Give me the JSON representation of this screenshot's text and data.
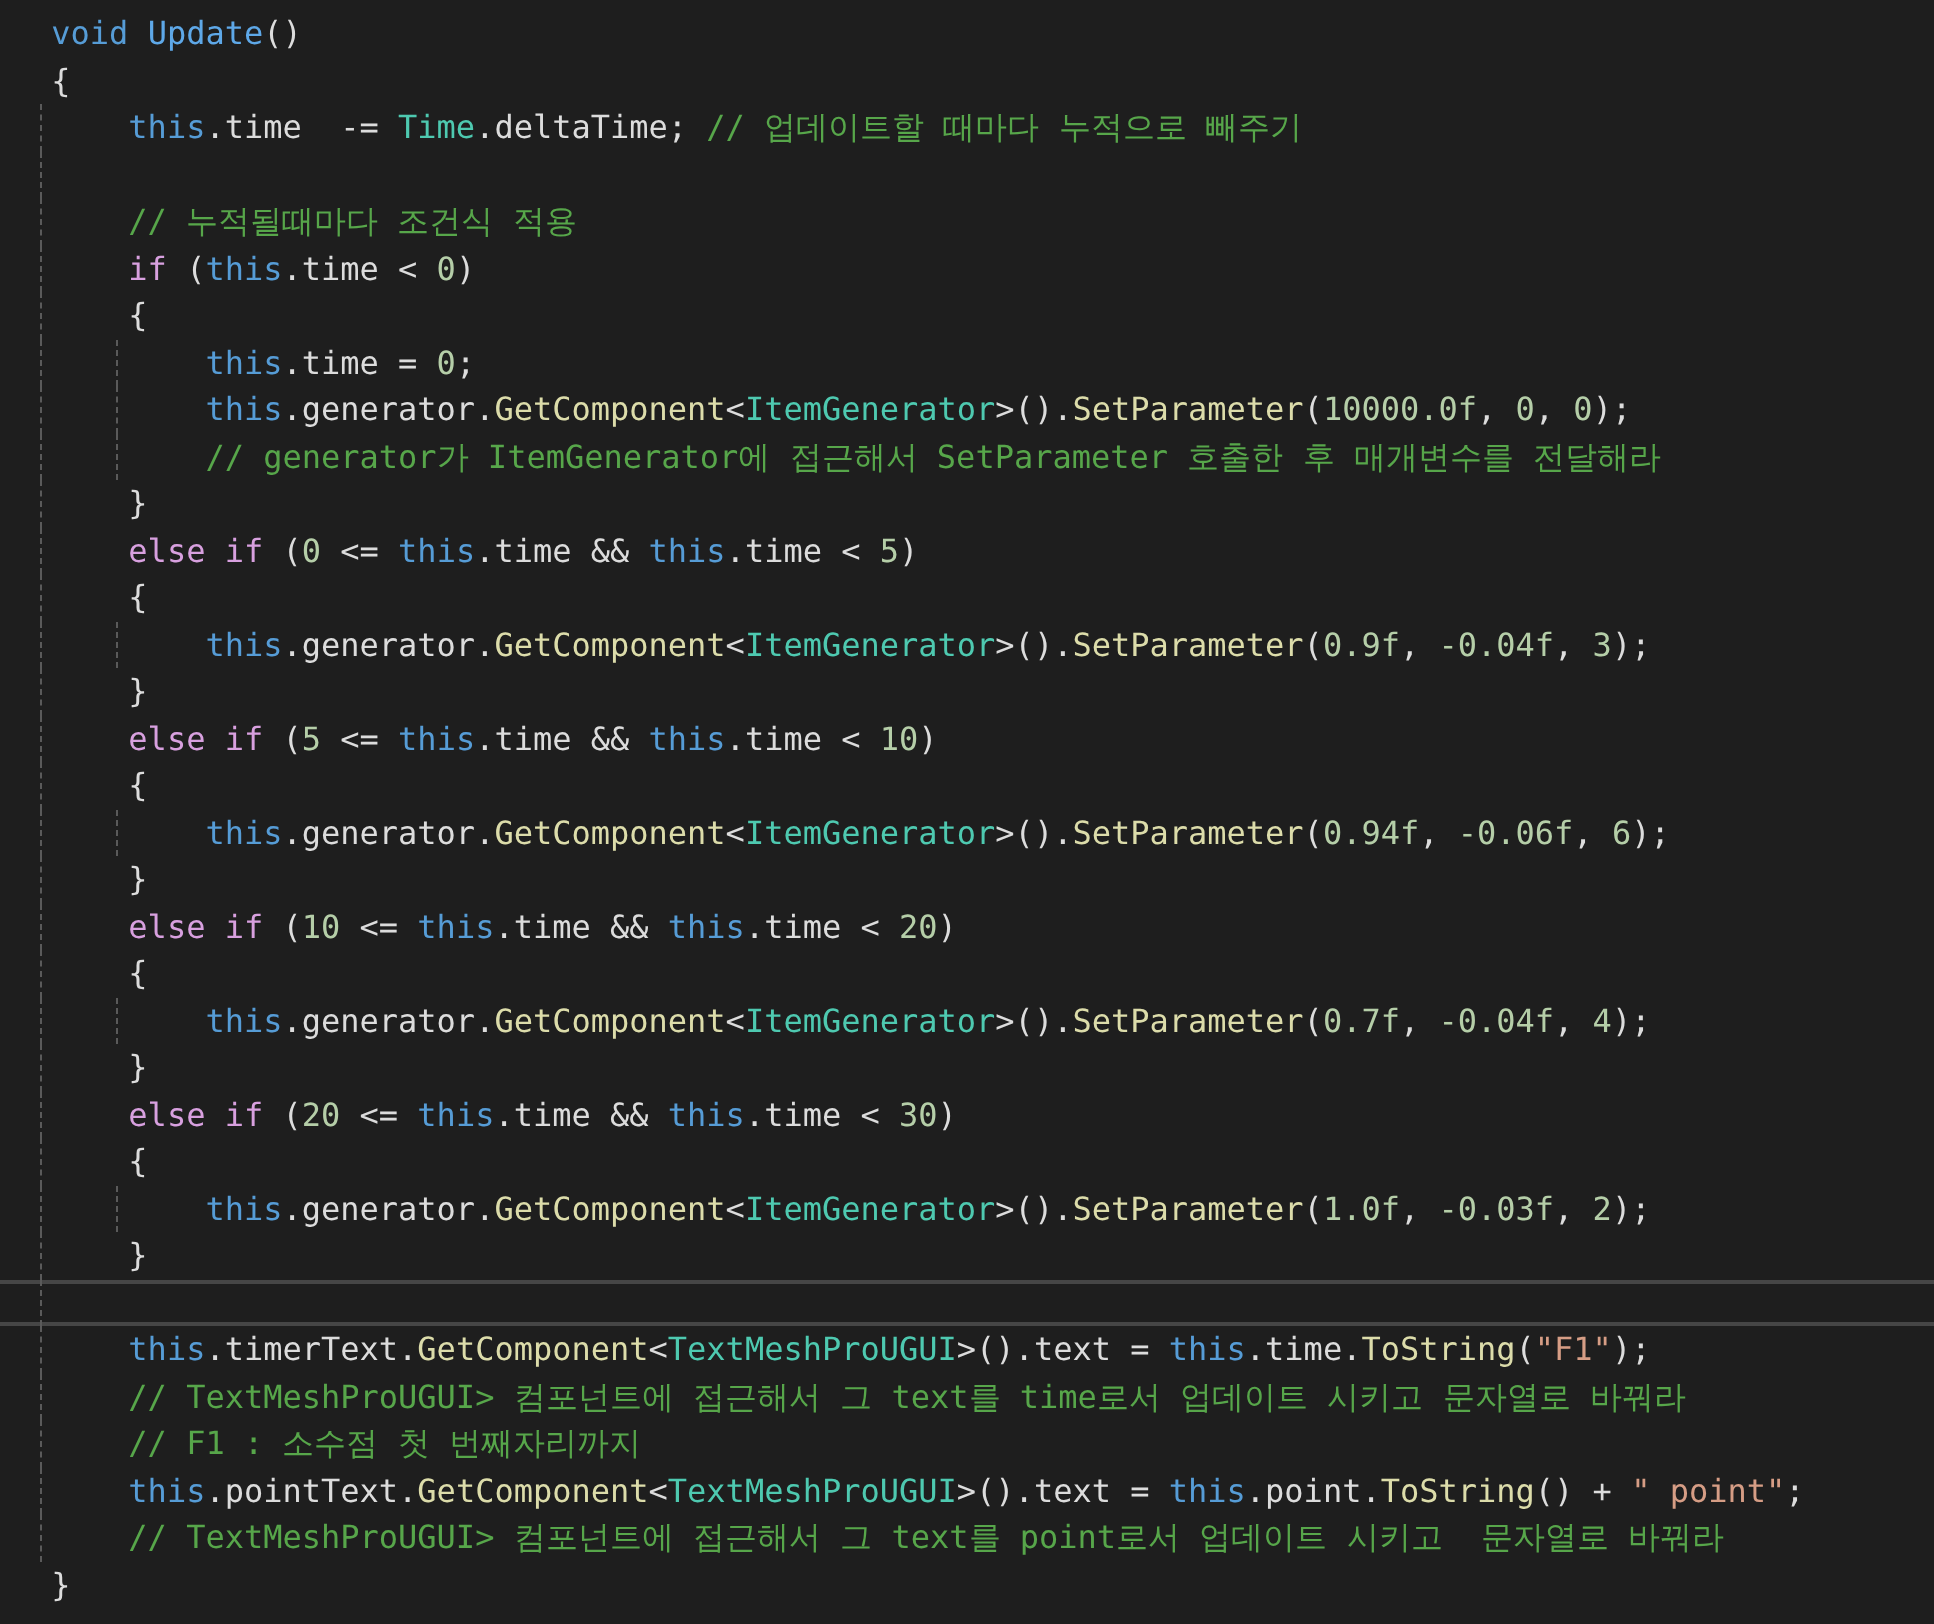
{
  "editor": {
    "lines": [
      {
        "current": false,
        "tokens": [
          {
            "kind": "kw",
            "text": "void "
          },
          {
            "kind": "decl",
            "text": "Update"
          },
          {
            "kind": "plain",
            "text": "()"
          }
        ]
      },
      {
        "current": false,
        "tokens": [
          {
            "kind": "plain",
            "text": "{"
          }
        ]
      },
      {
        "current": false,
        "tokens": [
          {
            "kind": "this",
            "text": "    this"
          },
          {
            "kind": "plain",
            "text": ".time  -= "
          },
          {
            "kind": "type",
            "text": "Time"
          },
          {
            "kind": "plain",
            "text": ".deltaTime; "
          },
          {
            "kind": "cmt",
            "text": "// 업데이트할 때마다 누적으로 빼주기"
          }
        ]
      },
      {
        "current": false
      },
      {
        "current": false,
        "tokens": [
          {
            "kind": "cmt",
            "text": "    // 누적될때마다 조건식 적용"
          }
        ]
      },
      {
        "current": false,
        "tokens": [
          {
            "kind": "ctl",
            "text": "    if"
          },
          {
            "kind": "plain",
            "text": " ("
          },
          {
            "kind": "this",
            "text": "this"
          },
          {
            "kind": "plain",
            "text": ".time < "
          },
          {
            "kind": "num",
            "text": "0"
          },
          {
            "kind": "plain",
            "text": ")"
          }
        ]
      },
      {
        "current": false,
        "tokens": [
          {
            "kind": "plain",
            "text": "    {"
          }
        ]
      },
      {
        "current": false,
        "tokens": [
          {
            "kind": "this",
            "text": "        this"
          },
          {
            "kind": "plain",
            "text": ".time = "
          },
          {
            "kind": "num",
            "text": "0"
          },
          {
            "kind": "plain",
            "text": ";"
          }
        ]
      },
      {
        "current": false,
        "tokens": [
          {
            "kind": "this",
            "text": "        this"
          },
          {
            "kind": "plain",
            "text": ".generator."
          },
          {
            "kind": "method",
            "text": "GetComponent"
          },
          {
            "kind": "plain",
            "text": "<"
          },
          {
            "kind": "type",
            "text": "ItemGenerator"
          },
          {
            "kind": "plain",
            "text": ">()."
          },
          {
            "kind": "method",
            "text": "SetParameter"
          },
          {
            "kind": "plain",
            "text": "("
          },
          {
            "kind": "num",
            "text": "10000.0f"
          },
          {
            "kind": "plain",
            "text": ", "
          },
          {
            "kind": "num",
            "text": "0"
          },
          {
            "kind": "plain",
            "text": ", "
          },
          {
            "kind": "num",
            "text": "0"
          },
          {
            "kind": "plain",
            "text": ");"
          }
        ]
      },
      {
        "current": false,
        "tokens": [
          {
            "kind": "cmt",
            "text": "        // generator가 ItemGenerator에 접근해서 SetParameter 호출한 후 매개변수를 전달해라"
          }
        ]
      },
      {
        "current": false,
        "tokens": [
          {
            "kind": "plain",
            "text": "    }"
          }
        ]
      },
      {
        "current": false,
        "tokens": [
          {
            "kind": "ctl",
            "text": "    else if"
          },
          {
            "kind": "plain",
            "text": " ("
          },
          {
            "kind": "num",
            "text": "0"
          },
          {
            "kind": "plain",
            "text": " <= "
          },
          {
            "kind": "this",
            "text": "this"
          },
          {
            "kind": "plain",
            "text": ".time && "
          },
          {
            "kind": "this",
            "text": "this"
          },
          {
            "kind": "plain",
            "text": ".time < "
          },
          {
            "kind": "num",
            "text": "5"
          },
          {
            "kind": "plain",
            "text": ")"
          }
        ]
      },
      {
        "current": false,
        "tokens": [
          {
            "kind": "plain",
            "text": "    {"
          }
        ]
      },
      {
        "current": false,
        "tokens": [
          {
            "kind": "this",
            "text": "        this"
          },
          {
            "kind": "plain",
            "text": ".generator."
          },
          {
            "kind": "method",
            "text": "GetComponent"
          },
          {
            "kind": "plain",
            "text": "<"
          },
          {
            "kind": "type",
            "text": "ItemGenerator"
          },
          {
            "kind": "plain",
            "text": ">()."
          },
          {
            "kind": "method",
            "text": "SetParameter"
          },
          {
            "kind": "plain",
            "text": "("
          },
          {
            "kind": "num",
            "text": "0.9f"
          },
          {
            "kind": "plain",
            "text": ", "
          },
          {
            "kind": "num",
            "text": "-0.04f"
          },
          {
            "kind": "plain",
            "text": ", "
          },
          {
            "kind": "num",
            "text": "3"
          },
          {
            "kind": "plain",
            "text": ");"
          }
        ]
      },
      {
        "current": false,
        "tokens": [
          {
            "kind": "plain",
            "text": "    }"
          }
        ]
      },
      {
        "current": false,
        "tokens": [
          {
            "kind": "ctl",
            "text": "    else if"
          },
          {
            "kind": "plain",
            "text": " ("
          },
          {
            "kind": "num",
            "text": "5"
          },
          {
            "kind": "plain",
            "text": " <= "
          },
          {
            "kind": "this",
            "text": "this"
          },
          {
            "kind": "plain",
            "text": ".time && "
          },
          {
            "kind": "this",
            "text": "this"
          },
          {
            "kind": "plain",
            "text": ".time < "
          },
          {
            "kind": "num",
            "text": "10"
          },
          {
            "kind": "plain",
            "text": ")"
          }
        ]
      },
      {
        "current": false,
        "tokens": [
          {
            "kind": "plain",
            "text": "    {"
          }
        ]
      },
      {
        "current": false,
        "tokens": [
          {
            "kind": "this",
            "text": "        this"
          },
          {
            "kind": "plain",
            "text": ".generator."
          },
          {
            "kind": "method",
            "text": "GetComponent"
          },
          {
            "kind": "plain",
            "text": "<"
          },
          {
            "kind": "type",
            "text": "ItemGenerator"
          },
          {
            "kind": "plain",
            "text": ">()."
          },
          {
            "kind": "method",
            "text": "SetParameter"
          },
          {
            "kind": "plain",
            "text": "("
          },
          {
            "kind": "num",
            "text": "0.94f"
          },
          {
            "kind": "plain",
            "text": ", "
          },
          {
            "kind": "num",
            "text": "-0.06f"
          },
          {
            "kind": "plain",
            "text": ", "
          },
          {
            "kind": "num",
            "text": "6"
          },
          {
            "kind": "plain",
            "text": ");"
          }
        ]
      },
      {
        "current": false,
        "tokens": [
          {
            "kind": "plain",
            "text": "    }"
          }
        ]
      },
      {
        "current": false,
        "tokens": [
          {
            "kind": "ctl",
            "text": "    else if"
          },
          {
            "kind": "plain",
            "text": " ("
          },
          {
            "kind": "num",
            "text": "10"
          },
          {
            "kind": "plain",
            "text": " <= "
          },
          {
            "kind": "this",
            "text": "this"
          },
          {
            "kind": "plain",
            "text": ".time && "
          },
          {
            "kind": "this",
            "text": "this"
          },
          {
            "kind": "plain",
            "text": ".time < "
          },
          {
            "kind": "num",
            "text": "20"
          },
          {
            "kind": "plain",
            "text": ")"
          }
        ]
      },
      {
        "current": false,
        "tokens": [
          {
            "kind": "plain",
            "text": "    {"
          }
        ]
      },
      {
        "current": false,
        "tokens": [
          {
            "kind": "this",
            "text": "        this"
          },
          {
            "kind": "plain",
            "text": ".generator."
          },
          {
            "kind": "method",
            "text": "GetComponent"
          },
          {
            "kind": "plain",
            "text": "<"
          },
          {
            "kind": "type",
            "text": "ItemGenerator"
          },
          {
            "kind": "plain",
            "text": ">()."
          },
          {
            "kind": "method",
            "text": "SetParameter"
          },
          {
            "kind": "plain",
            "text": "("
          },
          {
            "kind": "num",
            "text": "0.7f"
          },
          {
            "kind": "plain",
            "text": ", "
          },
          {
            "kind": "num",
            "text": "-0.04f"
          },
          {
            "kind": "plain",
            "text": ", "
          },
          {
            "kind": "num",
            "text": "4"
          },
          {
            "kind": "plain",
            "text": ");"
          }
        ]
      },
      {
        "current": false,
        "tokens": [
          {
            "kind": "plain",
            "text": "    }"
          }
        ]
      },
      {
        "current": false,
        "tokens": [
          {
            "kind": "ctl",
            "text": "    else if"
          },
          {
            "kind": "plain",
            "text": " ("
          },
          {
            "kind": "num",
            "text": "20"
          },
          {
            "kind": "plain",
            "text": " <= "
          },
          {
            "kind": "this",
            "text": "this"
          },
          {
            "kind": "plain",
            "text": ".time && "
          },
          {
            "kind": "this",
            "text": "this"
          },
          {
            "kind": "plain",
            "text": ".time < "
          },
          {
            "kind": "num",
            "text": "30"
          },
          {
            "kind": "plain",
            "text": ")"
          }
        ]
      },
      {
        "current": false,
        "tokens": [
          {
            "kind": "plain",
            "text": "    {"
          }
        ]
      },
      {
        "current": false,
        "tokens": [
          {
            "kind": "this",
            "text": "        this"
          },
          {
            "kind": "plain",
            "text": ".generator."
          },
          {
            "kind": "method",
            "text": "GetComponent"
          },
          {
            "kind": "plain",
            "text": "<"
          },
          {
            "kind": "type",
            "text": "ItemGenerator"
          },
          {
            "kind": "plain",
            "text": ">()."
          },
          {
            "kind": "method",
            "text": "SetParameter"
          },
          {
            "kind": "plain",
            "text": "("
          },
          {
            "kind": "num",
            "text": "1.0f"
          },
          {
            "kind": "plain",
            "text": ", "
          },
          {
            "kind": "num",
            "text": "-0.03f"
          },
          {
            "kind": "plain",
            "text": ", "
          },
          {
            "kind": "num",
            "text": "2"
          },
          {
            "kind": "plain",
            "text": ");"
          }
        ]
      },
      {
        "current": false,
        "tokens": [
          {
            "kind": "plain",
            "text": "    }"
          }
        ]
      },
      {
        "current": true
      },
      {
        "current": false,
        "tokens": [
          {
            "kind": "this",
            "text": "    this"
          },
          {
            "kind": "plain",
            "text": ".timerText."
          },
          {
            "kind": "method",
            "text": "GetComponent"
          },
          {
            "kind": "plain",
            "text": "<"
          },
          {
            "kind": "type",
            "text": "TextMeshProUGUI"
          },
          {
            "kind": "plain",
            "text": ">().text = "
          },
          {
            "kind": "this",
            "text": "this"
          },
          {
            "kind": "plain",
            "text": ".time."
          },
          {
            "kind": "method",
            "text": "ToString"
          },
          {
            "kind": "plain",
            "text": "("
          },
          {
            "kind": "str",
            "text": "\"F1\""
          },
          {
            "kind": "plain",
            "text": ");"
          }
        ]
      },
      {
        "current": false,
        "tokens": [
          {
            "kind": "cmt",
            "text": "    // TextMeshProUGUI> 컴포넌트에 접근해서 그 text를 time로서 업데이트 시키고 문자열로 바꿔라"
          }
        ]
      },
      {
        "current": false,
        "tokens": [
          {
            "kind": "cmt",
            "text": "    // F1 : 소수점 첫 번째자리까지"
          }
        ]
      },
      {
        "current": false,
        "tokens": [
          {
            "kind": "this",
            "text": "    this"
          },
          {
            "kind": "plain",
            "text": ".pointText."
          },
          {
            "kind": "method",
            "text": "GetComponent"
          },
          {
            "kind": "plain",
            "text": "<"
          },
          {
            "kind": "type",
            "text": "TextMeshProUGUI"
          },
          {
            "kind": "plain",
            "text": ">().text = "
          },
          {
            "kind": "this",
            "text": "this"
          },
          {
            "kind": "plain",
            "text": ".point."
          },
          {
            "kind": "method",
            "text": "ToString"
          },
          {
            "kind": "plain",
            "text": "() + "
          },
          {
            "kind": "str",
            "text": "\" point\""
          },
          {
            "kind": "plain",
            "text": ";"
          }
        ]
      },
      {
        "current": false,
        "tokens": [
          {
            "kind": "cmt",
            "text": "    // TextMeshProUGUI> 컴포넌트에 접근해서 그 text를 point로서 업데이트 시키고  문자열로 바꿔라"
          }
        ]
      },
      {
        "current": false,
        "tokens": [
          {
            "kind": "plain",
            "text": "}"
          }
        ]
      }
    ]
  }
}
